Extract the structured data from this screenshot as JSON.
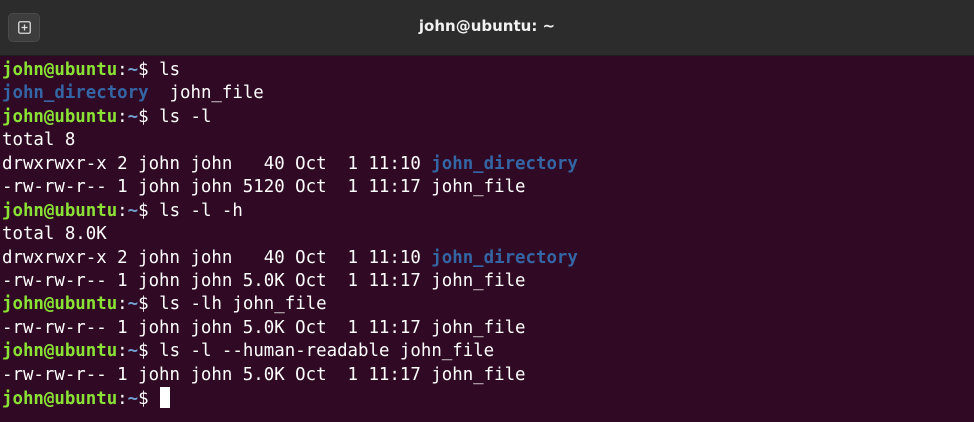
{
  "window": {
    "title": "john@ubuntu: ~"
  },
  "colors": {
    "background": "#300a24",
    "titlebar": "#2c2c2c",
    "prompt_user": "#8ae234",
    "prompt_path": "#729fcf",
    "directory": "#3465a4",
    "text": "#ffffff"
  },
  "icons": {
    "new_tab": "new-tab-icon"
  },
  "prompt": {
    "user_host": "john@ubuntu",
    "colon": ":",
    "path": "~",
    "symbol": "$ "
  },
  "lines": [
    {
      "type": "prompt",
      "command": "ls"
    },
    {
      "type": "ls_short",
      "dir": "john_directory",
      "sep": "  ",
      "file": "john_file"
    },
    {
      "type": "prompt",
      "command": "ls -l"
    },
    {
      "type": "output",
      "text": "total 8"
    },
    {
      "type": "entry",
      "prefix": "drwxrwxr-x 2 john john   40 Oct  1 11:10 ",
      "name": "john_directory",
      "is_dir": true
    },
    {
      "type": "entry",
      "prefix": "-rw-rw-r-- 1 john john 5120 Oct  1 11:17 ",
      "name": "john_file",
      "is_dir": false
    },
    {
      "type": "prompt",
      "command": "ls -l -h"
    },
    {
      "type": "output",
      "text": "total 8.0K"
    },
    {
      "type": "entry",
      "prefix": "drwxrwxr-x 2 john john   40 Oct  1 11:10 ",
      "name": "john_directory",
      "is_dir": true
    },
    {
      "type": "entry",
      "prefix": "-rw-rw-r-- 1 john john 5.0K Oct  1 11:17 ",
      "name": "john_file",
      "is_dir": false
    },
    {
      "type": "prompt",
      "command": "ls -lh john_file"
    },
    {
      "type": "entry",
      "prefix": "-rw-rw-r-- 1 john john 5.0K Oct  1 11:17 ",
      "name": "john_file",
      "is_dir": false
    },
    {
      "type": "prompt",
      "command": "ls -l --human-readable john_file"
    },
    {
      "type": "entry",
      "prefix": "-rw-rw-r-- 1 john john 5.0K Oct  1 11:17 ",
      "name": "john_file",
      "is_dir": false
    },
    {
      "type": "prompt",
      "command": "",
      "cursor": true
    }
  ]
}
